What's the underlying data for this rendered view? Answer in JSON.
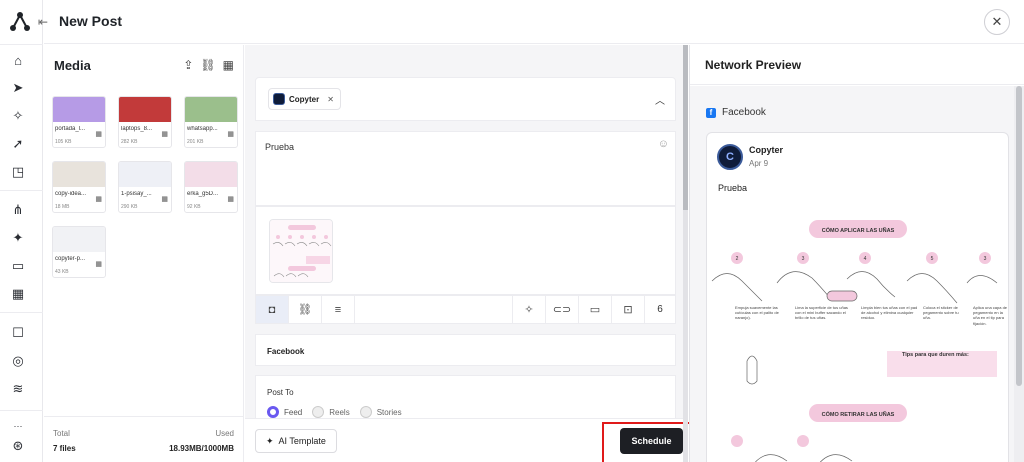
{
  "header": {
    "title": "New Post"
  },
  "media": {
    "title": "Media",
    "items": [
      {
        "name": "portada_l...",
        "size": "105 KB",
        "color": "#b69be6"
      },
      {
        "name": "laptops_8...",
        "size": "282 KB",
        "color": "#c23a3a"
      },
      {
        "name": "whatsapp...",
        "size": "201 KB",
        "color": "#9bbf8c"
      },
      {
        "name": "copy-idea...",
        "size": "18 MB",
        "color": "#e8e3dc"
      },
      {
        "name": "1-psisay_...",
        "size": "290 KB",
        "color": "#eef0f6"
      },
      {
        "name": "erka_g5D...",
        "size": "92 KB",
        "color": "#f3dde8"
      },
      {
        "name": "copyter-p...",
        "size": "43 KB",
        "color": "#f1f2f5"
      }
    ],
    "footer": {
      "total_label": "Total",
      "files": "7 files",
      "used_label": "Used",
      "used_value": "18.93MB/1000MB"
    }
  },
  "editor": {
    "channel_chip": "Copyter",
    "post_text": "Prueba",
    "media_count": "6",
    "facebook_section": "Facebook",
    "post_to_label": "Post To",
    "post_types": [
      "Feed",
      "Reels",
      "Stories"
    ],
    "selected_type": "Feed",
    "ai_template_label": "AI Template",
    "schedule_label": "Schedule"
  },
  "preview": {
    "title": "Network Preview",
    "network": "Facebook",
    "account_name": "Copyter",
    "date": "Apr 9",
    "text": "Prueba",
    "image_heading_1": "CÓMO APLICAR LAS UÑAS",
    "image_heading_2": "CÓMO RETIRAR LAS UÑAS",
    "tips_title": "Tips para que duren más:",
    "step_numbers": [
      "2",
      "3",
      "4",
      "5",
      "3"
    ],
    "step_texts": [
      "Empuja suavemente las cutículas con el palito de naranjo).",
      "Lima la superficie de tus uñas con el mini buffer sacando el brillo de tus uñas.",
      "Limpia bien tus uñas con el pad de alcohol y elimina cualquier residuo.",
      "Coloca el sticker de pegamento sobre tu uña.",
      "Aplica una capa de pegamento en la uña en el tip para fijación."
    ]
  },
  "colors": {
    "accent": "#6a59f0",
    "highlight": "#e01a1a",
    "dark_button": "#1d1f24",
    "facebook": "#1877f2"
  }
}
